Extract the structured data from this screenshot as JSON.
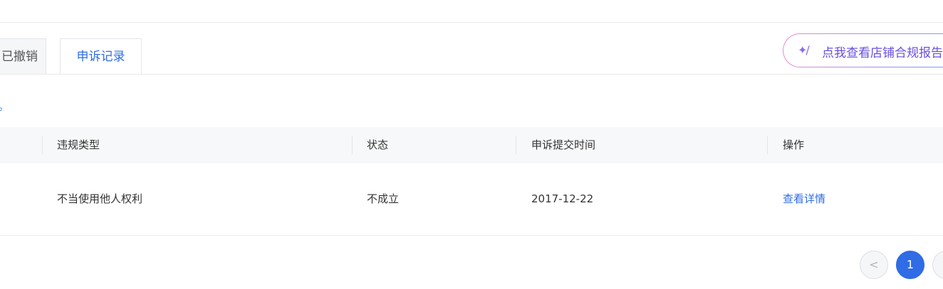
{
  "tabs": [
    {
      "label": "已撤销"
    },
    {
      "label": "申诉记录"
    }
  ],
  "report_button": {
    "label": "点我查看店铺合规报告",
    "icon": "sparkle-wand-icon"
  },
  "hint": {
    "text": "。"
  },
  "table": {
    "columns": [
      "违规类型",
      "状态",
      "申诉提交时间",
      "操作"
    ],
    "rows": [
      {
        "violation_type": "不当使用他人权利",
        "status": "不成立",
        "submitted_at": "2017-12-22",
        "action": "查看详情"
      }
    ]
  },
  "pagination": {
    "prev": "<",
    "current": "1",
    "next": ">"
  },
  "colors": {
    "accent": "#2f6ce5",
    "header_bg": "#f7f8fa"
  }
}
